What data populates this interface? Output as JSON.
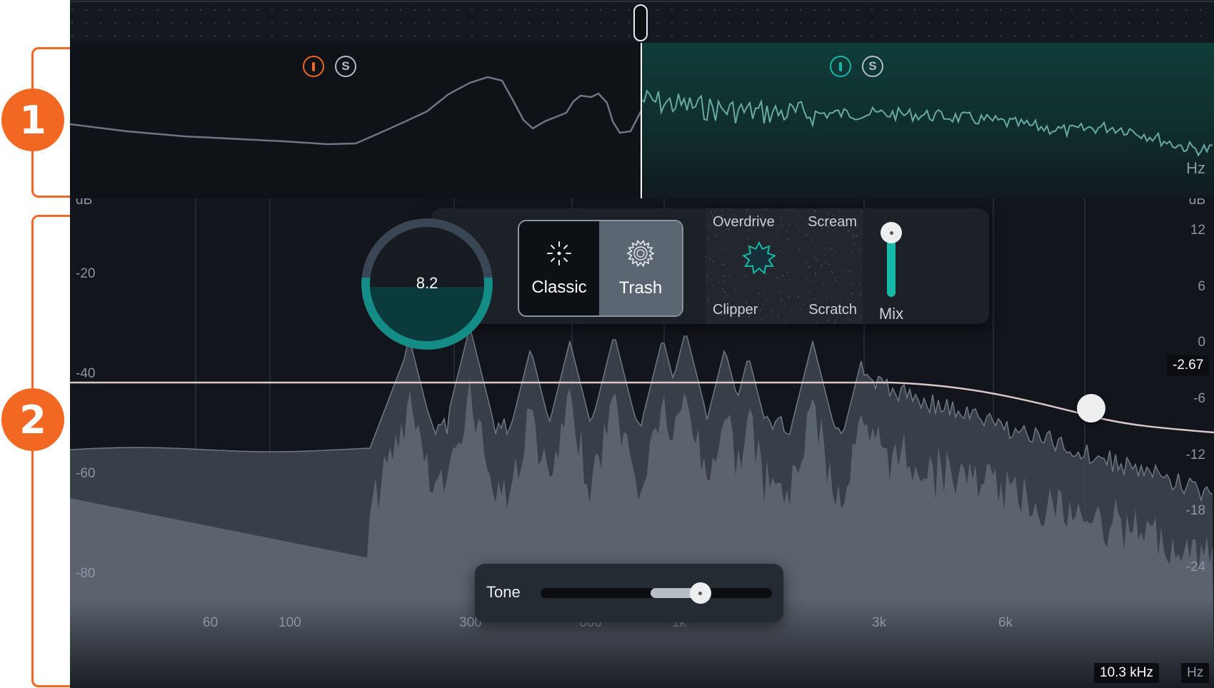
{
  "callouts": [
    "1",
    "2"
  ],
  "upper": {
    "band_left": {
      "power_color": "#f26722",
      "solo_label": "S"
    },
    "band_right": {
      "power_color": "#17b8a6",
      "solo_label": "S"
    },
    "unit": "Hz"
  },
  "axis": {
    "left_title": "dB",
    "right_title": "dB",
    "left_labels": [
      "-20",
      "-40",
      "-60",
      "-80"
    ],
    "right_labels": [
      "12",
      "6",
      "0",
      "-6",
      "-12",
      "-18",
      "-24"
    ],
    "freq_labels": [
      "60",
      "100",
      "300",
      "600",
      "1k",
      "3k",
      "6k"
    ],
    "freq_unit": "Hz",
    "cursor_freq": "10.3 kHz"
  },
  "drive": {
    "value": "8.2",
    "fill_fraction": 0.55,
    "modes": [
      {
        "label": "Classic",
        "icon": "spark-icon",
        "selected": false
      },
      {
        "label": "Trash",
        "icon": "gear-burst-icon",
        "selected": true
      }
    ],
    "xy_pad": {
      "top_left": "Overdrive",
      "top_right": "Scream",
      "bottom_left": "Clipper",
      "bottom_right": "Scratch"
    },
    "mix_label": "Mix",
    "mix_level": 0.85
  },
  "filter": {
    "node_value": "-2.67"
  },
  "tone": {
    "label": "Tone",
    "level": 0.69
  },
  "colors": {
    "accent": "#17b8a6",
    "callout": "#f26722",
    "background": "#12151b"
  }
}
